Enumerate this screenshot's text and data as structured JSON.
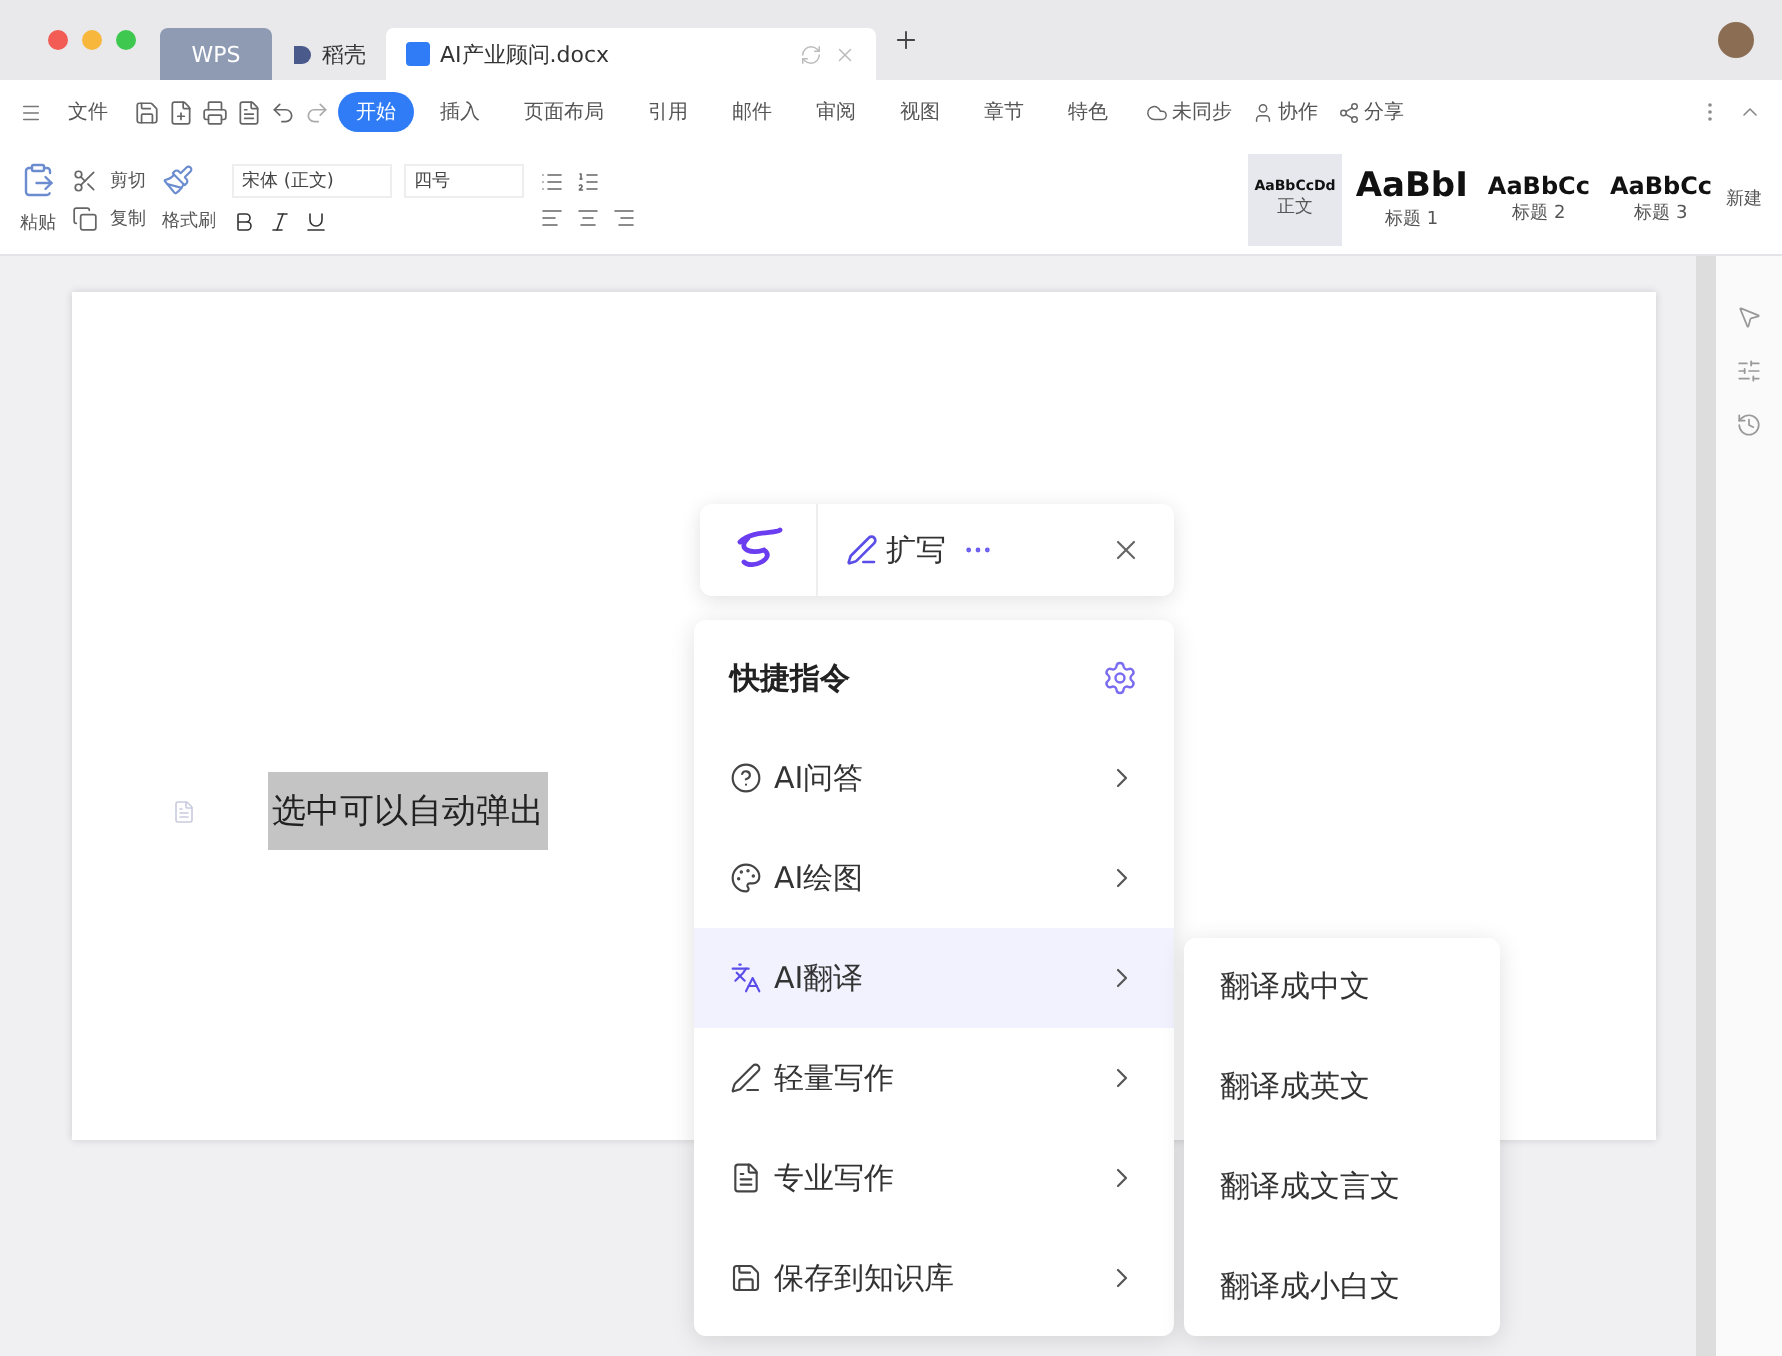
{
  "tabs": [
    {
      "label": "WPS",
      "kind": "brand",
      "selected": false
    },
    {
      "label": "稻壳",
      "kind": "app",
      "selected": false
    },
    {
      "label": "AI产业顾问.docx",
      "kind": "doc",
      "selected": true
    }
  ],
  "menu": {
    "file": "文件",
    "items": [
      {
        "label": "开始",
        "selected": true
      },
      {
        "label": "插入",
        "selected": false
      },
      {
        "label": "页面布局",
        "selected": false
      },
      {
        "label": "引用",
        "selected": false
      },
      {
        "label": "邮件",
        "selected": false
      },
      {
        "label": "审阅",
        "selected": false
      },
      {
        "label": "视图",
        "selected": false
      },
      {
        "label": "章节",
        "selected": false
      },
      {
        "label": "特色",
        "selected": false
      }
    ],
    "actions": [
      "未同步",
      "协作",
      "分享"
    ]
  },
  "ribbon": {
    "cut": "剪切",
    "copy": "复制",
    "paste": "粘贴",
    "format_painter": "格式刷",
    "font": "宋体 (正文)",
    "size": "四号",
    "styles": [
      {
        "preview": "AaBbCcDd",
        "label": "正文",
        "kind": "small",
        "selected": true
      },
      {
        "preview": "AaBbI",
        "label": "标题 1",
        "kind": "large",
        "selected": false
      },
      {
        "preview": "AaBbCc",
        "label": "标题 2",
        "kind": "medium",
        "selected": false
      },
      {
        "preview": "AaBbCc",
        "label": "标题 3",
        "kind": "medium",
        "selected": false
      }
    ],
    "new_style": "新建"
  },
  "document": {
    "selected_text": "选中可以自动弹出"
  },
  "ai_toolbar": {
    "expand": "扩写"
  },
  "ai_menu": {
    "title": "快捷指令",
    "items": [
      {
        "label": "AI问答",
        "selected": false
      },
      {
        "label": "AI绘图",
        "selected": false
      },
      {
        "label": "AI翻译",
        "selected": true
      },
      {
        "label": "轻量写作",
        "selected": false
      },
      {
        "label": "专业写作",
        "selected": false
      },
      {
        "label": "保存到知识库",
        "selected": false
      }
    ]
  },
  "submenu": {
    "items": [
      "翻译成中文",
      "翻译成英文",
      "翻译成文言文",
      "翻译成小白文"
    ]
  }
}
